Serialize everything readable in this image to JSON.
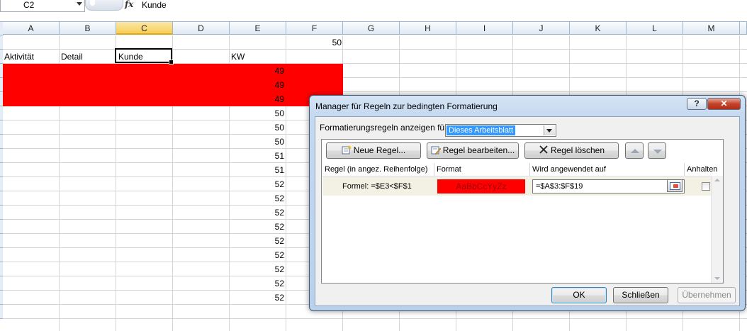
{
  "formula_bar": {
    "name_box": "C2",
    "fx_symbol": "fx",
    "formula": "Kunde"
  },
  "sheet": {
    "columns": [
      "A",
      "B",
      "C",
      "D",
      "E",
      "F",
      "G",
      "H",
      "I",
      "J",
      "K",
      "L",
      "M"
    ],
    "selected_column": "C",
    "f1_value": "50",
    "headers": {
      "a": "Aktivität",
      "b": "Detail",
      "c": "Kunde",
      "e": "KW"
    },
    "kw_values": [
      "49",
      "49",
      "49",
      "50",
      "50",
      "50",
      "51",
      "51",
      "52",
      "52",
      "52",
      "52",
      "52",
      "52",
      "52",
      "52",
      "52"
    ],
    "highlight_color": "#ff0000"
  },
  "dialog": {
    "title": "Manager für Regeln zur bedingten Formatierung",
    "help_label": "?",
    "close_label": "✕",
    "show_rules_label": "Formatierungsregeln anzeigen für:",
    "scope_value": "Dieses Arbeitsblatt",
    "buttons": {
      "new_rule": "Neue Regel...",
      "edit_rule": "Regel bearbeiten...",
      "delete_rule": "Regel löschen",
      "ok": "OK",
      "close": "Schließen",
      "apply": "Übernehmen"
    },
    "columns": {
      "rule": "Regel (in angez. Reihenfolge)",
      "format": "Format",
      "applies_to": "Wird angewendet auf",
      "stop": "Anhalten"
    },
    "rule": {
      "formula": "Formel: =$E3<$F$1",
      "preview_text": "AaBbCcYyZz",
      "applies_to": "=$A$3:$F$19",
      "stop_if_true": false
    }
  }
}
